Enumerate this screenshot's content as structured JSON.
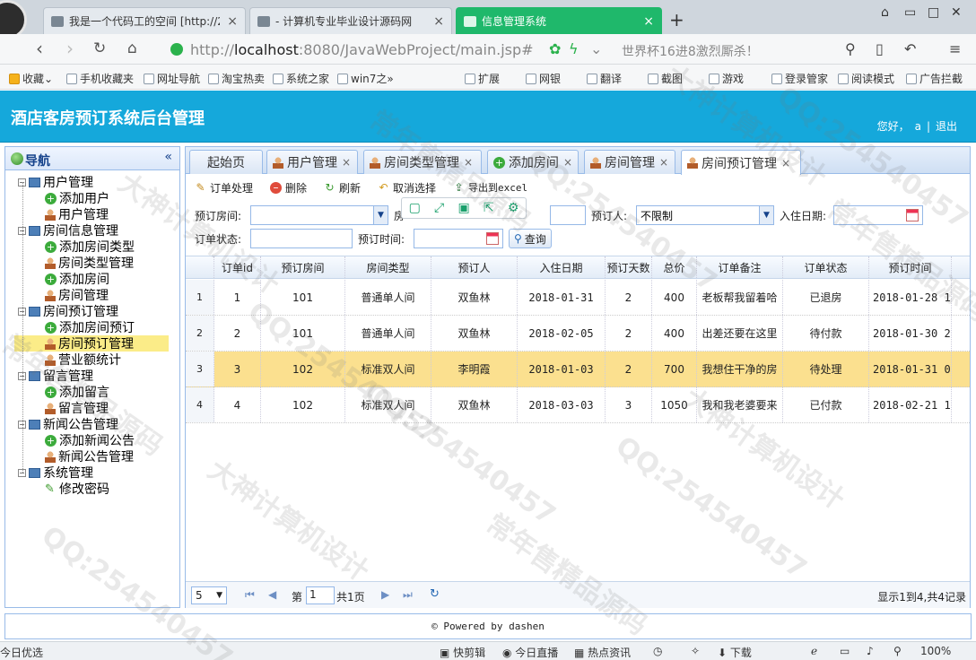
{
  "browser": {
    "tabs": [
      {
        "label": "我是一个代码工的空间 [http://2",
        "close": "×"
      },
      {
        "label": "- 计算机专业毕业设计源码网",
        "close": "×"
      },
      {
        "label": "信息管理系统",
        "close": "×"
      }
    ],
    "new_tab": "+",
    "url_host": "localhost",
    "url_prefix": "http://",
    "url_rest": ":8080/JavaWebProject/main.jsp#",
    "news": "世界杯16进8激烈厮杀！",
    "bookmarks": [
      "收藏",
      "手机收藏夹",
      "网址导航",
      "淘宝热卖",
      "系统之家",
      "win7之"
    ],
    "right_tools": [
      "扩展",
      "网银",
      "翻译",
      "截图",
      "游戏",
      "登录管家",
      "阅读模式",
      "广告拦截"
    ],
    "statusbar": {
      "left": "今日优选",
      "items": [
        "快剪辑",
        "今日直播",
        "热点资讯",
        "下载"
      ],
      "zoom": "100%"
    }
  },
  "app": {
    "title": "酒店客房预订系统后台管理",
    "welcome": "您好，",
    "user": "a",
    "logout": "退出",
    "footer": "Powered by dashen",
    "accent": "#15a8db"
  },
  "nav": {
    "title": "导航",
    "collapse": "«",
    "items": [
      {
        "label": "用户管理",
        "type": "group"
      },
      {
        "label": "添加用户",
        "type": "add"
      },
      {
        "label": "用户管理",
        "type": "user"
      },
      {
        "label": "房间信息管理",
        "type": "group"
      },
      {
        "label": "添加房间类型",
        "type": "add"
      },
      {
        "label": "房间类型管理",
        "type": "user"
      },
      {
        "label": "添加房间",
        "type": "add"
      },
      {
        "label": "房间管理",
        "type": "user"
      },
      {
        "label": "房间预订管理",
        "type": "group"
      },
      {
        "label": "添加房间预订",
        "type": "add"
      },
      {
        "label": "房间预订管理",
        "type": "user"
      },
      {
        "label": "营业额统计",
        "type": "user"
      },
      {
        "label": "留言管理",
        "type": "group"
      },
      {
        "label": "添加留言",
        "type": "add"
      },
      {
        "label": "留言管理",
        "type": "user"
      },
      {
        "label": "新闻公告管理",
        "type": "group"
      },
      {
        "label": "添加新闻公告",
        "type": "add"
      },
      {
        "label": "新闻公告管理",
        "type": "user"
      },
      {
        "label": "系统管理",
        "type": "group"
      },
      {
        "label": "修改密码",
        "type": "pen"
      }
    ],
    "selected_index": 10
  },
  "tabs": [
    {
      "label": "起始页"
    },
    {
      "label": "用户管理"
    },
    {
      "label": "房间类型管理"
    },
    {
      "label": "添加房间"
    },
    {
      "label": "房间管理"
    },
    {
      "label": "房间预订管理"
    }
  ],
  "toolbar": {
    "process": "订单处理",
    "delete": "删除",
    "refresh": "刷新",
    "unselect": "取消选择",
    "export": "导出到excel"
  },
  "search": {
    "room_label": "预订房间:",
    "room_value": "",
    "room_clip": "房",
    "booker_label": "预订人:",
    "booker_value": "不限制",
    "checkin_label": "入住日期:",
    "checkin_value": "",
    "status_label": "订单状态:",
    "status_value": "",
    "time_label": "预订时间:",
    "time_value": "",
    "query": "查询"
  },
  "grid": {
    "columns": [
      "订单id",
      "预订房间",
      "房间类型",
      "预订人",
      "入住日期",
      "预订天数",
      "总价",
      "订单备注",
      "订单状态",
      "预订时间"
    ],
    "rows": [
      {
        "n": "1",
        "id": "1",
        "room": "101",
        "type": "普通单人间",
        "booker": "双鱼林",
        "checkin": "2018-01-31",
        "days": "2",
        "price": "400",
        "note": "老板帮我留着哈",
        "status": "已退房",
        "time": "2018-01-28 17"
      },
      {
        "n": "2",
        "id": "2",
        "room": "101",
        "type": "普通单人间",
        "booker": "双鱼林",
        "checkin": "2018-02-05",
        "days": "2",
        "price": "400",
        "note": "出差还要在这里",
        "status": "待付款",
        "time": "2018-01-30 23"
      },
      {
        "n": "3",
        "id": "3",
        "room": "102",
        "type": "标准双人间",
        "booker": "李明霞",
        "checkin": "2018-01-03",
        "days": "2",
        "price": "700",
        "note": "我想住干净的房",
        "status": "待处理",
        "time": "2018-01-31 00"
      },
      {
        "n": "4",
        "id": "4",
        "room": "102",
        "type": "标准双人间",
        "booker": "双鱼林",
        "checkin": "2018-03-03",
        "days": "3",
        "price": "1050",
        "note": "我和我老婆要来",
        "status": "已付款",
        "time": "2018-02-21 16"
      }
    ],
    "selected_row": 2
  },
  "pager": {
    "page_size": "5",
    "page_prefix": "第",
    "page": "1",
    "page_total": "共1页",
    "summary": "显示1到4,共4记录"
  },
  "watermarks": [
    "大神计算机设计",
    "QQ:254540457",
    "常年售精品源码"
  ]
}
